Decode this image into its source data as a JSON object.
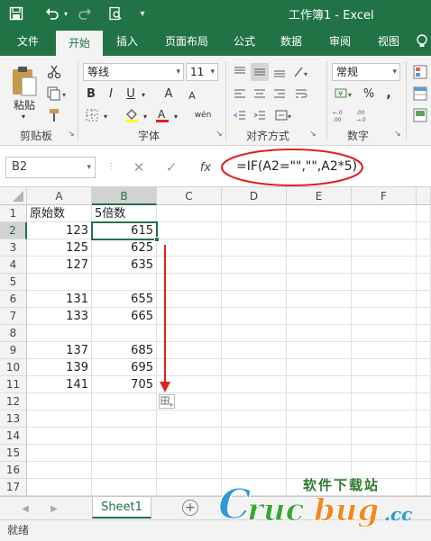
{
  "title": {
    "text": "工作簿1 - Excel"
  },
  "quick_access": {
    "save_icon": "save-icon",
    "undo_icon": "undo-icon",
    "redo_icon": "redo-icon",
    "preview_icon": "print-preview-icon"
  },
  "tabs": [
    {
      "label": "文件"
    },
    {
      "label": "开始"
    },
    {
      "label": "插入"
    },
    {
      "label": "页面布局"
    },
    {
      "label": "公式"
    },
    {
      "label": "数据"
    },
    {
      "label": "审阅"
    },
    {
      "label": "视图"
    }
  ],
  "ribbon": {
    "clipboard": {
      "label": "剪贴板",
      "paste_label": "粘贴"
    },
    "font": {
      "label": "字体",
      "font_name": "等线",
      "font_size": "11",
      "bold": "B",
      "italic": "I",
      "underline": "U",
      "grow": "A",
      "shrink": "A",
      "wen": "wén"
    },
    "alignment": {
      "label": "对齐方式"
    },
    "number": {
      "label": "数字",
      "format": "常规",
      "percent": "%",
      "comma": ","
    }
  },
  "formula_bar": {
    "name_box": "B2",
    "fx": "fx",
    "formula": "=IF(A2=\"\",\"\",A2*5)"
  },
  "columns": [
    "A",
    "B",
    "C",
    "D",
    "E",
    "F"
  ],
  "rows": [
    {
      "num": "1",
      "a": "原始数",
      "b": "5倍数"
    },
    {
      "num": "2",
      "a": "123",
      "b": "615"
    },
    {
      "num": "3",
      "a": "125",
      "b": "625"
    },
    {
      "num": "4",
      "a": "127",
      "b": "635"
    },
    {
      "num": "5",
      "a": "",
      "b": ""
    },
    {
      "num": "6",
      "a": "131",
      "b": "655"
    },
    {
      "num": "7",
      "a": "133",
      "b": "665"
    },
    {
      "num": "8",
      "a": "",
      "b": ""
    },
    {
      "num": "9",
      "a": "137",
      "b": "685"
    },
    {
      "num": "10",
      "a": "139",
      "b": "695"
    },
    {
      "num": "11",
      "a": "141",
      "b": "705"
    },
    {
      "num": "12",
      "a": "",
      "b": ""
    },
    {
      "num": "13",
      "a": "",
      "b": ""
    },
    {
      "num": "14",
      "a": "",
      "b": ""
    },
    {
      "num": "15",
      "a": "",
      "b": ""
    },
    {
      "num": "16",
      "a": "",
      "b": ""
    },
    {
      "num": "17",
      "a": "",
      "b": ""
    }
  ],
  "sheet_tab": {
    "label": "Sheet1",
    "add": "+"
  },
  "status": {
    "text": "就绪"
  },
  "watermark": {
    "text": "软件下载站",
    "brand": "Crucbug.cc"
  },
  "colors": {
    "accent": "#217346",
    "annotation": "#e02020"
  }
}
